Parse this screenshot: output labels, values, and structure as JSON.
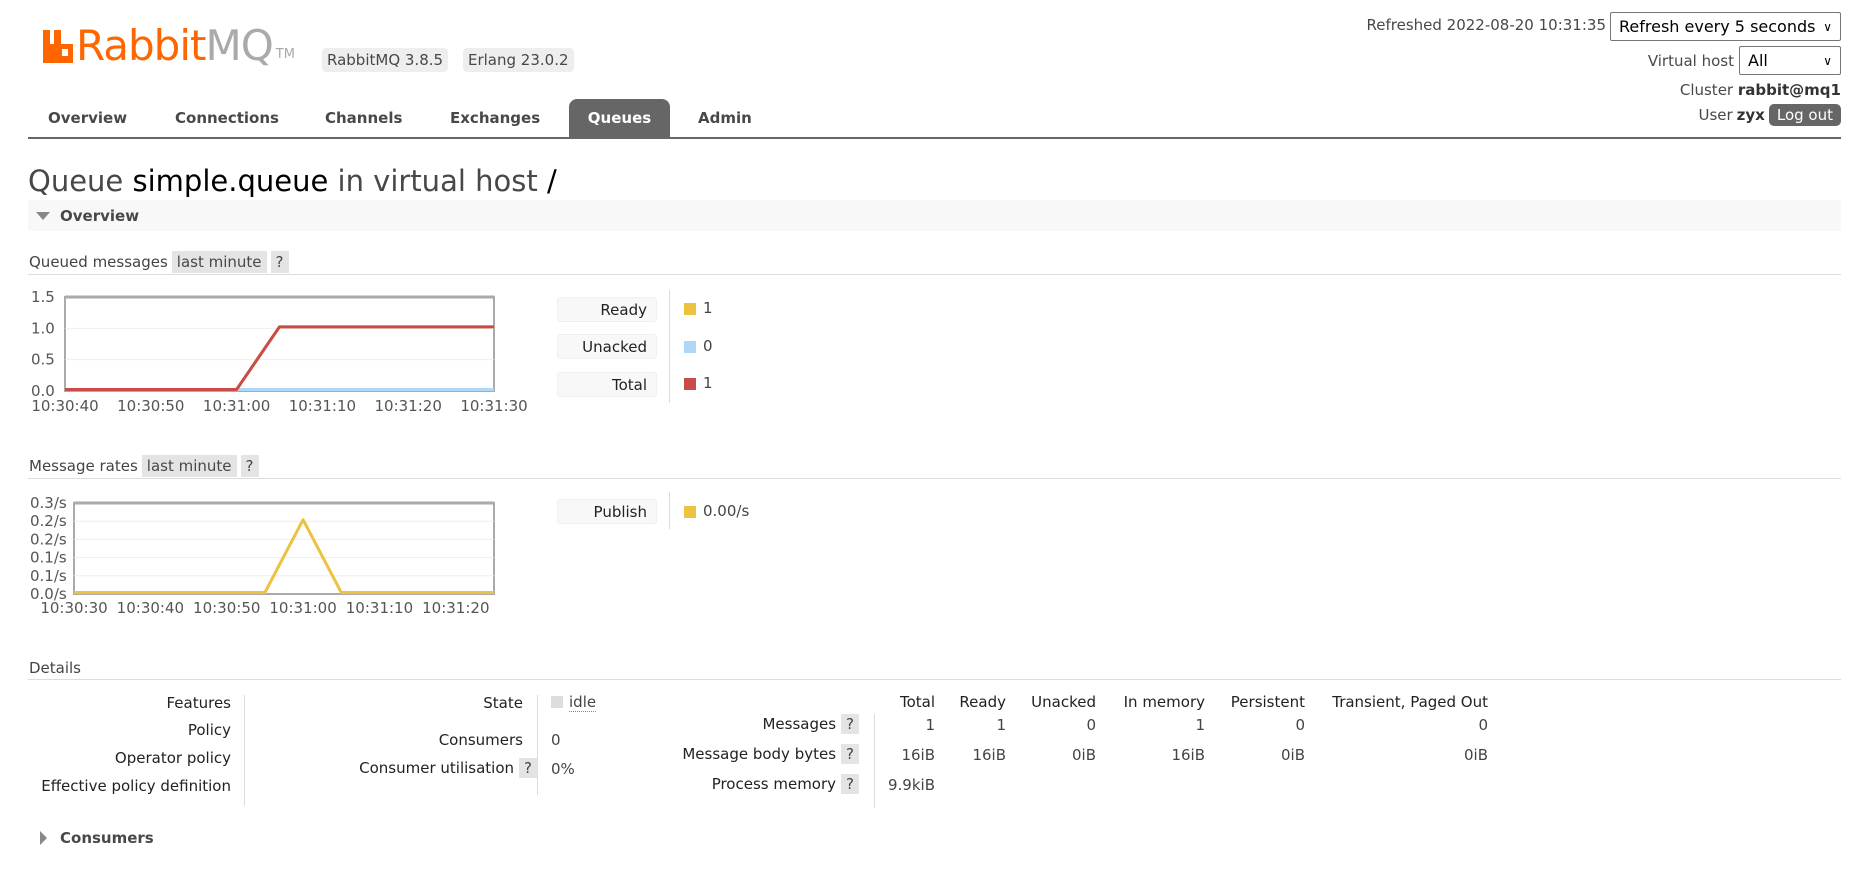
{
  "header": {
    "logo_text_1": "Rabbit",
    "logo_text_2": "MQ",
    "logo_tm": "TM",
    "version": "RabbitMQ 3.8.5",
    "erlang": "Erlang 23.0.2",
    "refreshed": "Refreshed 2022-08-20 10:31:35",
    "refresh_select": "Refresh every 5 seconds",
    "vhost_label": "Virtual host",
    "vhost_select": "All",
    "cluster_label": "Cluster",
    "cluster_name": "rabbit@mq1",
    "user_label": "User",
    "user_name": "zyx",
    "logout": "Log out",
    "brand_color": "#ff6600"
  },
  "nav": {
    "tabs": [
      {
        "label": "Overview"
      },
      {
        "label": "Connections"
      },
      {
        "label": "Channels"
      },
      {
        "label": "Exchanges"
      },
      {
        "label": "Queues",
        "active": true
      },
      {
        "label": "Admin"
      }
    ]
  },
  "page": {
    "title_prefix": "Queue",
    "queue_name": "simple.queue",
    "title_mid": "in virtual host",
    "vhost": "/",
    "section_overview": "Overview",
    "queued_label": "Queued messages",
    "queued_range": "last minute",
    "rates_label": "Message rates",
    "rates_range": "last minute",
    "help": "?",
    "details_label": "Details",
    "section_consumers": "Consumers"
  },
  "chart_data": [
    {
      "type": "line",
      "xlim": [
        "10:30:40",
        "10:31:30"
      ],
      "x_ticks": [
        "10:30:40",
        "10:30:50",
        "10:31:00",
        "10:31:10",
        "10:31:20",
        "10:31:30"
      ],
      "ylim": [
        0,
        1.5
      ],
      "y_ticks": [
        {
          "v": 0,
          "label": "0.0"
        },
        {
          "v": 0.5,
          "label": "0.5"
        },
        {
          "v": 1,
          "label": "1.0"
        },
        {
          "v": 1.5,
          "label": "1.5"
        }
      ],
      "grid": true,
      "legend": "right",
      "series": [
        {
          "name": "Ready",
          "current": "1",
          "color": "#edc240",
          "points": [
            [
              "10:30:40",
              0
            ],
            [
              "10:31:00",
              0
            ],
            [
              "10:31:05",
              1
            ],
            [
              "10:31:30",
              1
            ]
          ]
        },
        {
          "name": "Unacked",
          "current": "0",
          "color": "#afd8f8",
          "points": [
            [
              "10:31:00",
              0
            ],
            [
              "10:31:30",
              0
            ]
          ]
        },
        {
          "name": "Total",
          "current": "1",
          "color": "#cb4b4b",
          "points": [
            [
              "10:30:40",
              0
            ],
            [
              "10:31:00",
              0
            ],
            [
              "10:31:05",
              1
            ],
            [
              "10:31:30",
              1
            ]
          ]
        }
      ]
    },
    {
      "type": "line",
      "xlim": [
        "10:30:30",
        "10:31:25"
      ],
      "x_ticks": [
        "10:30:30",
        "10:30:40",
        "10:30:50",
        "10:31:00",
        "10:31:10",
        "10:31:20"
      ],
      "ylim": [
        0,
        0.25
      ],
      "y_ticks": [
        {
          "v": 0,
          "label": "0.0/s"
        },
        {
          "v": 0.05,
          "label": "0.1/s"
        },
        {
          "v": 0.1,
          "label": "0.1/s"
        },
        {
          "v": 0.15,
          "label": "0.2/s"
        },
        {
          "v": 0.2,
          "label": "0.2/s"
        },
        {
          "v": 0.25,
          "label": "0.3/s"
        }
      ],
      "grid": true,
      "legend": "right",
      "series": [
        {
          "name": "Publish",
          "current": "0.00/s",
          "color": "#edc240",
          "points": [
            [
              "10:30:30",
              0
            ],
            [
              "10:30:55",
              0
            ],
            [
              "10:31:00",
              0.2
            ],
            [
              "10:31:05",
              0
            ],
            [
              "10:31:25",
              0
            ]
          ]
        }
      ]
    }
  ],
  "details": {
    "left_labels": [
      "Features",
      "Policy",
      "Operator policy",
      "Effective policy definition"
    ],
    "state_label": "State",
    "state_value": "idle",
    "consumers_label": "Consumers",
    "consumers_value": "0",
    "utilisation_label": "Consumer utilisation",
    "utilisation_value": "0%",
    "table_headers": [
      "Total",
      "Ready",
      "Unacked",
      "In memory",
      "Persistent",
      "Transient, Paged Out"
    ],
    "rows": [
      {
        "label": "Messages",
        "values": [
          "1",
          "1",
          "0",
          "1",
          "0",
          "0"
        ]
      },
      {
        "label": "Message body bytes",
        "values": [
          "16iB",
          "16iB",
          "0iB",
          "16iB",
          "0iB",
          "0iB"
        ]
      },
      {
        "label": "Process memory",
        "values": [
          "9.9kiB"
        ]
      }
    ]
  }
}
